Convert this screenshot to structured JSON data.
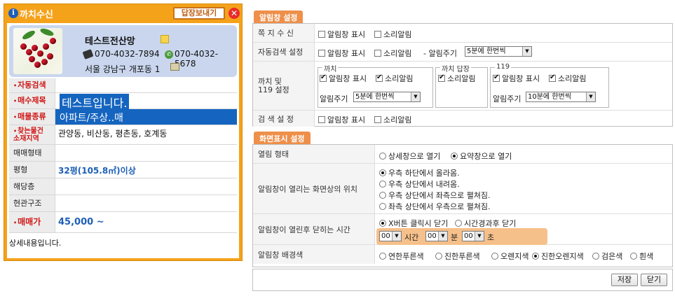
{
  "popup": {
    "title": "까치수신",
    "reply_label": "답장보내기",
    "close_label": "✕",
    "company": "테스트전산망",
    "phone": "070-4032-7894",
    "mobile": "070-4032-5678",
    "address": "서울 강남구 개포동 1",
    "rows": [
      {
        "label": "자동검색",
        "value": ""
      },
      {
        "label": "매수제목",
        "value": "테스트입니다."
      },
      {
        "label": "매물종류",
        "value": "아파트/주상..매"
      },
      {
        "label": "찾는물건\n소재지역",
        "value": "관양동, 비산동, 평촌동, 호계동"
      },
      {
        "label": "매매형태",
        "value": ""
      },
      {
        "label": "평형",
        "value": "32평(105.8㎡)이상"
      },
      {
        "label": "해당층",
        "value": ""
      },
      {
        "label": "현관구조",
        "value": ""
      },
      {
        "label": "매매가",
        "value": "45,000 ~"
      }
    ],
    "detail": "상세내용입니다."
  },
  "alarm": {
    "tab": "알림창 설정",
    "rows": {
      "note": {
        "label": "쪽 지 수 신",
        "show": "알림창 표시",
        "sound": "소리알림"
      },
      "auto": {
        "label": "자동검색 설정",
        "show": "알림창 표시",
        "sound": "소리알림",
        "period_label": "- 알림주기",
        "period": "5분에 한번씩"
      },
      "kkachi": {
        "label": "까치 및\n119 설정",
        "group1": {
          "legend": "까치",
          "show": "알림창 표시",
          "sound": "소리알림",
          "period_label": "알림주기",
          "period": "5분에 한번씩"
        },
        "group2": {
          "legend": "까치 답장",
          "sound": "소리알림"
        },
        "group3": {
          "legend": "119",
          "show": "알림창 표시",
          "sound": "소리알림",
          "period_label": "알림주기",
          "period": "10분에 한번씩"
        }
      },
      "search": {
        "label": "검 색 설 정",
        "show": "알림창 표시",
        "sound": "소리알림"
      }
    }
  },
  "display": {
    "tab": "화면표시 설정",
    "open_type": {
      "label": "열림 형태",
      "opt1": "상세창으로 열기",
      "opt2": "요약창으로 열기"
    },
    "position": {
      "label": "알림창이 열리는 화면상의 위치",
      "opts": [
        "우측 하단에서 올라옴.",
        "우측 상단에서 내려옴.",
        "우측 상단에서 좌측으로 펼쳐짐.",
        "좌측 상단에서 우측으로 펼쳐짐."
      ]
    },
    "close": {
      "label": "알림창이 열린후 닫히는 시간",
      "opt1": "X버튼 클릭시 닫기",
      "opt2": "시간경과후 닫기",
      "hour": "00",
      "hour_label": "시간",
      "min": "00",
      "min_label": "분",
      "sec": "00",
      "sec_label": "초"
    },
    "bg": {
      "label": "알림창 배경색",
      "opts": [
        "연한푸른색",
        "진한푸른색",
        "오렌지색",
        "진한오렌지색",
        "검은색",
        "흰색"
      ]
    }
  },
  "footer": {
    "save": "저장",
    "close": "닫기"
  },
  "colors": {
    "popup": "#f5a21b",
    "tab": "#ee8f4a",
    "highlight_row": "#1565c0",
    "blue_value": "#1d5fb8",
    "red_label": "#d01818"
  }
}
